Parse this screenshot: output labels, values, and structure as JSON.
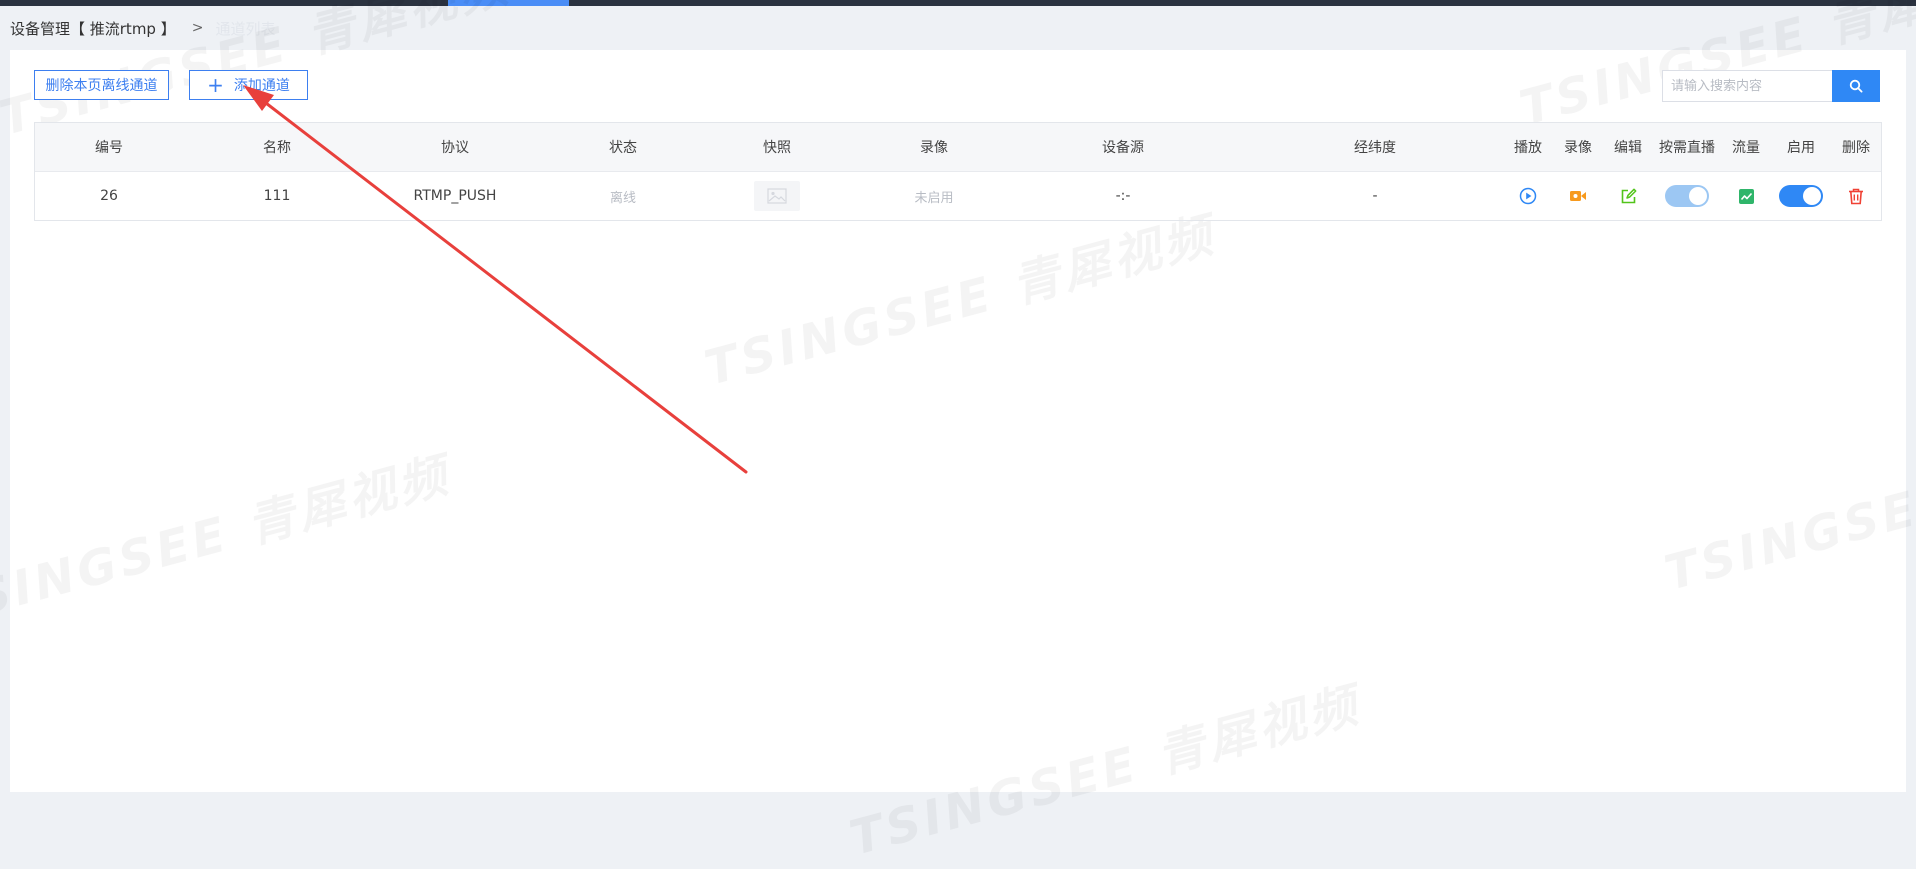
{
  "breadcrumb": {
    "main": "设备管理【 推流rtmp 】",
    "separator": ">",
    "current": "通道列表"
  },
  "toolbar": {
    "delete_offline_label": "删除本页离线通道",
    "add_channel_label": "添加通道",
    "add_icon": "plus-icon"
  },
  "search": {
    "placeholder": "请输入搜索内容",
    "button_icon": "search-icon"
  },
  "table": {
    "headers": [
      "编号",
      "名称",
      "协议",
      "状态",
      "快照",
      "录像",
      "设备源",
      "经纬度",
      "播放",
      "录像",
      "编辑",
      "按需直播",
      "流量",
      "启用",
      "删除"
    ],
    "rows": [
      {
        "id": "26",
        "name": "111",
        "protocol": "RTMP_PUSH",
        "status": "离线",
        "snapshot_icon": "image-placeholder-icon",
        "record": "未启用",
        "device_source": "-:-",
        "lat_lng": "-",
        "play_icon": "play-circle-icon",
        "record_icon": "video-camera-icon",
        "edit_icon": "edit-icon",
        "on_demand": true,
        "traffic_icon": "chart-icon",
        "enabled": true,
        "delete_icon": "trash-icon"
      }
    ]
  },
  "watermark": "TSINGSEE 青犀视频",
  "colors": {
    "primary": "#2f88f5",
    "button_border": "#3d7ff0",
    "play": "#2f88f5",
    "record": "#f79a1e",
    "edit": "#52c41a",
    "traffic": "#2fb56a",
    "delete": "#f04134",
    "annotation_arrow": "#e8403c"
  }
}
